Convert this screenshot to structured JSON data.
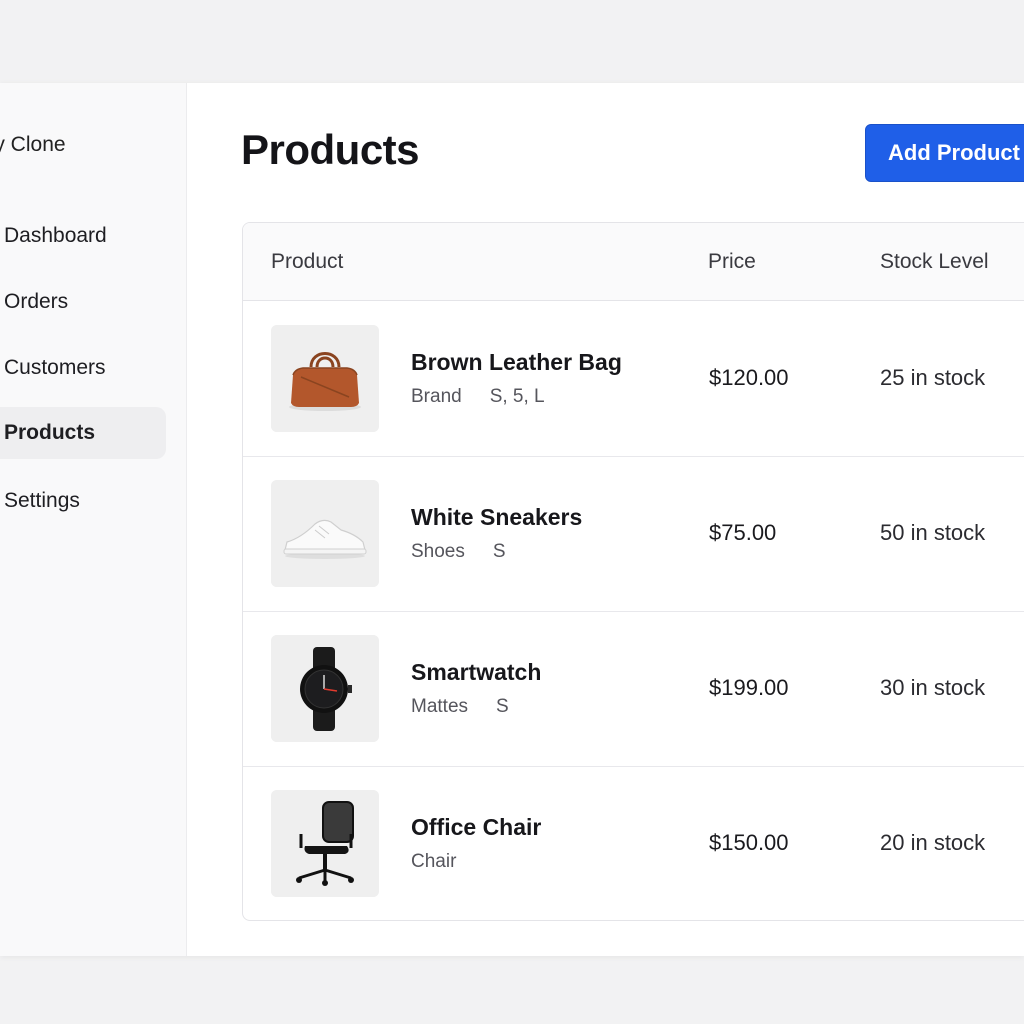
{
  "app": {
    "brand": "lpy Clone"
  },
  "sidebar": {
    "items": [
      {
        "label": "Dashboard",
        "active": false
      },
      {
        "label": "Orders",
        "active": false
      },
      {
        "label": "Customers",
        "active": false
      },
      {
        "label": "Products",
        "active": true
      },
      {
        "label": "Settings",
        "active": false
      }
    ]
  },
  "header": {
    "title": "Products",
    "add_button": "Add Product"
  },
  "table": {
    "columns": [
      "Product",
      "Price",
      "Stock Level"
    ],
    "rows": [
      {
        "name": "Brown Leather Bag",
        "category": "Brand",
        "sizes": "S, 5, L",
        "price": "$120.00",
        "stock": "25 in stock",
        "icon": "bag-icon"
      },
      {
        "name": "White Sneakers",
        "category": "Shoes",
        "sizes": "S",
        "price": "$75.00",
        "stock": "50 in stock",
        "icon": "sneaker-icon"
      },
      {
        "name": "Smartwatch",
        "category": "Mattes",
        "sizes": "S",
        "price": "$199.00",
        "stock": "30 in stock",
        "icon": "watch-icon"
      },
      {
        "name": "Office Chair",
        "category": "Chair",
        "sizes": "",
        "price": "$150.00",
        "stock": "20 in stock",
        "icon": "chair-icon"
      }
    ]
  },
  "colors": {
    "accent": "#1f5fe8",
    "sidebar_bg": "#f9f9fa",
    "active_item_bg": "#eeeef0"
  }
}
